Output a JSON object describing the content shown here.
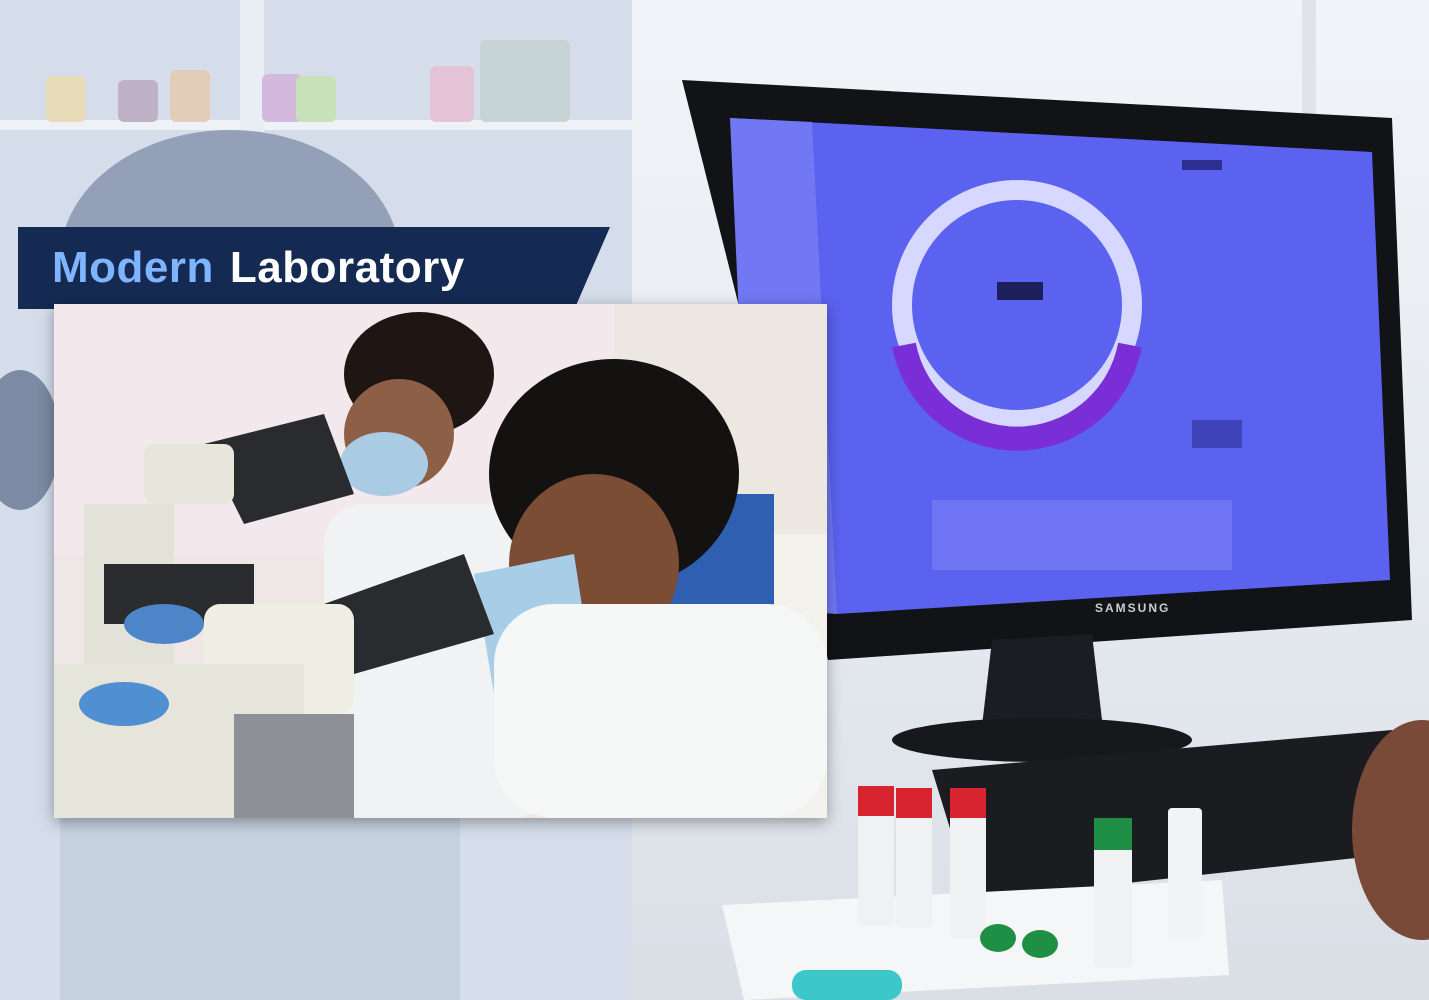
{
  "title": {
    "word1": "Modern",
    "word2": "Laboratory"
  },
  "monitor": {
    "brand": "SAMSUNG"
  },
  "colors": {
    "banner_bg": "#142a52",
    "accent_blue": "#7fb4ff",
    "text_white": "#ffffff",
    "screen_blue": "#5b62f0",
    "tube_red": "#d8242e",
    "tube_green": "#1f8f45"
  }
}
